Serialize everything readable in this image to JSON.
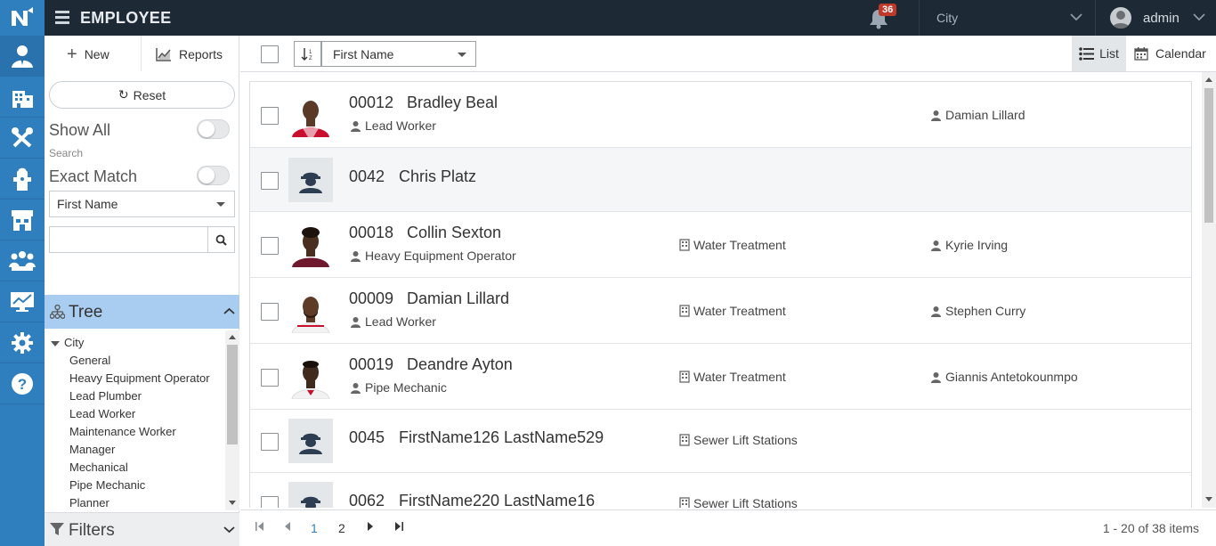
{
  "header": {
    "title": "EMPLOYEE",
    "notifications_count": "36",
    "city_select": "City",
    "user": "admin"
  },
  "left": {
    "new_label": "New",
    "reports_label": "Reports",
    "reset_label": "Reset",
    "show_all_label": "Show All",
    "search_label": "Search",
    "exact_match_label": "Exact Match",
    "search_field_select": "First Name",
    "search_placeholder": "",
    "tree_title": "Tree",
    "tree_root": "City",
    "tree_items": [
      "General",
      "Heavy Equipment Operator",
      "Lead Plumber",
      "Lead Worker",
      "Maintenance Worker",
      "Manager",
      "Mechanical",
      "Pipe Mechanic",
      "Planner"
    ],
    "filters_title": "Filters"
  },
  "toolbar": {
    "sort_field": "First Name",
    "list_label": "List",
    "calendar_label": "Calendar"
  },
  "employees": [
    {
      "id": "00012",
      "name": "Bradley Beal",
      "role": "Lead Worker",
      "dept": "",
      "supervisor": "Damian Lillard",
      "photo": "red"
    },
    {
      "id": "0042",
      "name": "Chris Platz",
      "role": "",
      "dept": "",
      "supervisor": "",
      "photo": "none"
    },
    {
      "id": "00018",
      "name": "Collin Sexton",
      "role": "Heavy Equipment Operator",
      "dept": "Water Treatment",
      "supervisor": "Kyrie Irving",
      "photo": "maroon"
    },
    {
      "id": "00009",
      "name": "Damian Lillard",
      "role": "Lead Worker",
      "dept": "Water Treatment",
      "supervisor": "Stephen Curry",
      "photo": "white"
    },
    {
      "id": "00019",
      "name": "Deandre Ayton",
      "role": "Pipe Mechanic",
      "dept": "Water Treatment",
      "supervisor": "Giannis Antetokounmpo",
      "photo": "white"
    },
    {
      "id": "0045",
      "name": "FirstName126 LastName529",
      "role": "",
      "dept": "Sewer Lift Stations",
      "supervisor": "",
      "photo": "none"
    },
    {
      "id": "0062",
      "name": "FirstName220 LastName16",
      "role": "",
      "dept": "Sewer Lift Stations",
      "supervisor": "",
      "photo": "none"
    }
  ],
  "pager": {
    "pages": [
      "1",
      "2"
    ],
    "current": "1",
    "info": "1 - 20 of 38 items"
  },
  "colors": {
    "accent": "#2f7fbf",
    "topbar": "#1d2a35",
    "tree_header": "#a8cdf0",
    "badge": "#c0392b"
  }
}
